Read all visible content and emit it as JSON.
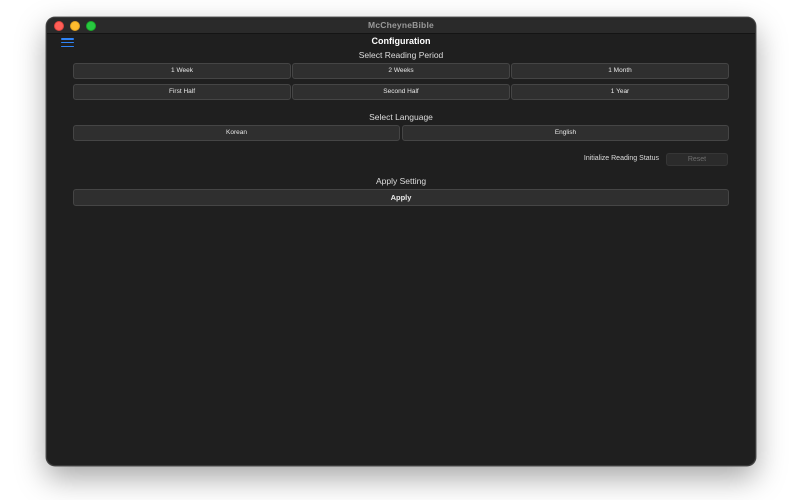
{
  "window": {
    "title": "McCheyneBible"
  },
  "header": {
    "menu_icon": "hamburger-menu-icon",
    "title": "Configuration"
  },
  "reading_period": {
    "heading": "Select Reading Period",
    "options": [
      "1 Week",
      "2 Weeks",
      "1 Month",
      "First Half",
      "Second Half",
      "1 Year"
    ]
  },
  "language": {
    "heading": "Select Language",
    "options": [
      "Korean",
      "English"
    ]
  },
  "reset": {
    "label": "Initialize Reading Status",
    "button_label": "Reset"
  },
  "apply": {
    "heading": "Apply Setting",
    "button_label": "Apply"
  },
  "colors": {
    "window_background": "#1f1f1f",
    "button_background": "#2f2f2f",
    "accent": "#2f83f6",
    "close": "#ff5f57",
    "minimize": "#febc2e",
    "maximize": "#28c840"
  }
}
